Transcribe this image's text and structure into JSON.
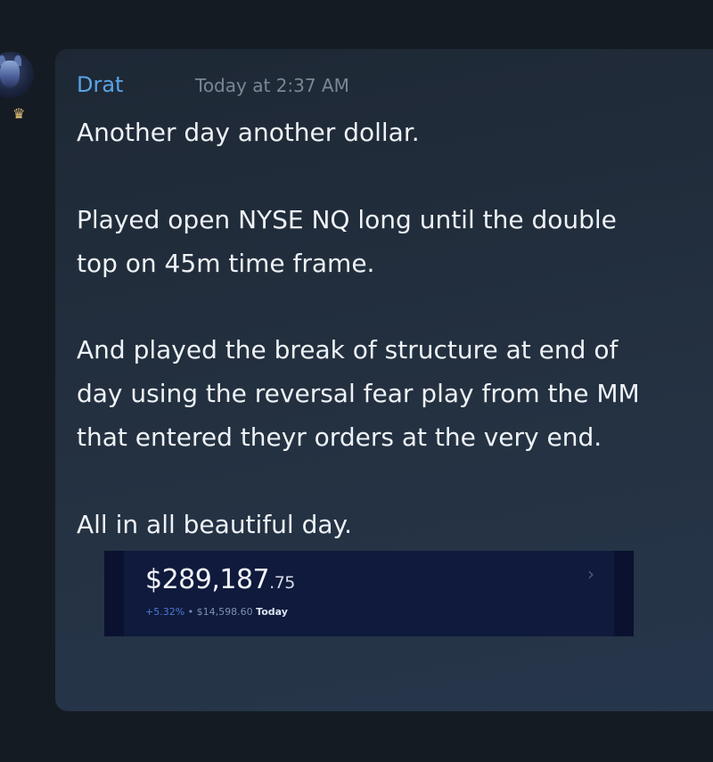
{
  "message": {
    "author": "Drat",
    "timestamp": "Today at 2:37 AM",
    "lines": [
      "Another day another dollar.",
      "Played open NYSE NQ long until the double",
      "top on 45m time frame.",
      "And played the break of structure at end of",
      "day using the reversal fear play from the MM",
      "that entered theyr orders at the very end.",
      "All in all beautiful day."
    ]
  },
  "embed": {
    "balance_main": "$289,187",
    "balance_cents": ".75",
    "change_pct": "+5.32%",
    "separator": "•",
    "change_amount": "$14,598.60",
    "period": "Today",
    "chevron": "›"
  },
  "colors": {
    "author_name": "#58a4e6",
    "background": "#151b23",
    "card": "#243141",
    "embed_background": "#0f1a3c"
  },
  "icons": {
    "avatar": "raccoon-avatar-icon",
    "badge": "crown-icon"
  }
}
